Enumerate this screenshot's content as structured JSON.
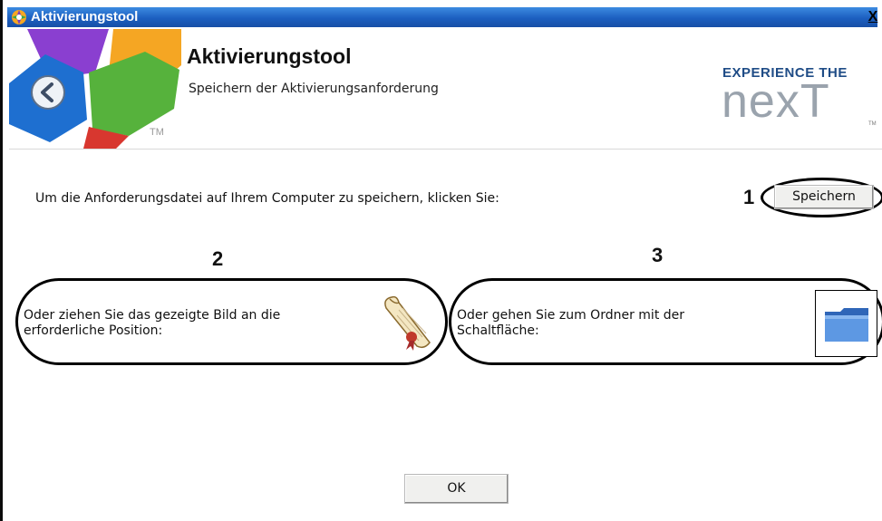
{
  "window": {
    "title": "Aktivierungstool",
    "close_glyph": "X"
  },
  "header": {
    "title": "Aktivierungstool",
    "subtitle": "Speichern der Aktivierungsanforderung",
    "logo_tm": "TM",
    "brand_line1": "EXPERIENCE THE",
    "brand_line2": "nexT",
    "brand_tm": "TM"
  },
  "main": {
    "instruction": "Um die Anforderungsdatei auf Ihrem Computer zu speichern, klicken Sie:",
    "save_button": "Speichern",
    "drag_option": {
      "text_line1": "Oder ziehen Sie das gezeigte Bild an die",
      "text_line2": "erforderliche Position:",
      "icon": "scroll-document-icon"
    },
    "folder_option": {
      "text_line1": "Oder gehen Sie zum Ordner mit der",
      "text_line2": "Schaltfläche:",
      "icon": "folder-icon"
    },
    "ok_button": "OK"
  },
  "annotations": {
    "marker_1": "1",
    "marker_2": "2",
    "marker_3": "3"
  },
  "colors": {
    "titlebar": "#1c5fc0",
    "brand_blue": "#1f4c86",
    "brand_grey": "#9aa3ad",
    "folder_blue": "#4a86d4"
  }
}
